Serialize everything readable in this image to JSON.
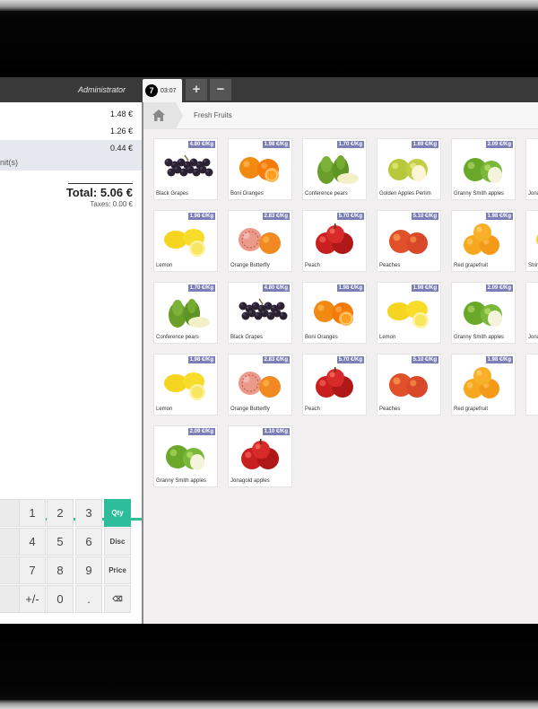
{
  "header": {
    "user": "Administrator",
    "order_number": "7",
    "order_time": "03:07",
    "add_label": "+",
    "remove_label": "−"
  },
  "order": {
    "lines": [
      {
        "price": "1.48 €"
      },
      {
        "price": "1.26 €"
      },
      {
        "price": "0.44 €",
        "unit": "nit(s)"
      }
    ],
    "total": "Total: 5.06 €",
    "taxes": "Taxes: 0.00 €"
  },
  "keypad": {
    "keys": [
      "1",
      "2",
      "3",
      "Qty",
      "4",
      "5",
      "6",
      "Disc",
      "7",
      "8",
      "9",
      "Price",
      "+/-",
      "0",
      ".",
      "⌫"
    ]
  },
  "breadcrumb": {
    "category": "Fresh Fruits"
  },
  "products": [
    {
      "name": "Black Grapes",
      "price": "4.80 €/Kg",
      "icon": "grapes"
    },
    {
      "name": "Boni Oranges",
      "price": "1.98 €/Kg",
      "icon": "orange"
    },
    {
      "name": "Conference pears",
      "price": "1.70 €/Kg",
      "icon": "pear"
    },
    {
      "name": "Golden Apples Perlim",
      "price": "1.69 €/Kg",
      "icon": "golden-apple"
    },
    {
      "name": "Granny Smith apples",
      "price": "2.09 €/Kg",
      "icon": "green-apple"
    },
    {
      "name": "Jona",
      "price": "",
      "icon": "red-apple"
    },
    {
      "name": "Lemon",
      "price": "1.98 €/Kg",
      "icon": "lemon"
    },
    {
      "name": "Orange Butterfly",
      "price": "2.83 €/Kg",
      "icon": "butterfly"
    },
    {
      "name": "Peach",
      "price": "5.70 €/Kg",
      "icon": "red-apple"
    },
    {
      "name": "Peaches",
      "price": "5.10 €/Kg",
      "icon": "peach"
    },
    {
      "name": "Red grapefruit",
      "price": "1.98 €/Kg",
      "icon": "grapefruit"
    },
    {
      "name": "Strir",
      "price": "",
      "icon": "lemon"
    },
    {
      "name": "Conference pears",
      "price": "1.70 €/Kg",
      "icon": "pear"
    },
    {
      "name": "Black Grapes",
      "price": "4.80 €/Kg",
      "icon": "grapes"
    },
    {
      "name": "Boni Oranges",
      "price": "1.98 €/Kg",
      "icon": "orange"
    },
    {
      "name": "Lemon",
      "price": "1.98 €/Kg",
      "icon": "lemon"
    },
    {
      "name": "Granny Smith apples",
      "price": "2.09 €/Kg",
      "icon": "green-apple"
    },
    {
      "name": "Jona",
      "price": "",
      "icon": "red-apple"
    },
    {
      "name": "Lemon",
      "price": "1.98 €/Kg",
      "icon": "lemon"
    },
    {
      "name": "Orange Butterfly",
      "price": "2.83 €/Kg",
      "icon": "butterfly"
    },
    {
      "name": "Peach",
      "price": "5.70 €/Kg",
      "icon": "red-apple"
    },
    {
      "name": "Peaches",
      "price": "5.10 €/Kg",
      "icon": "peach"
    },
    {
      "name": "Red grapefruit",
      "price": "1.98 €/Kg",
      "icon": "grapefruit"
    },
    {
      "name": "",
      "price": "",
      "icon": "green-apple"
    },
    {
      "name": "Granny Smith apples",
      "price": "2.09 €/Kg",
      "icon": "green-apple"
    },
    {
      "name": "Jonagold apples",
      "price": "1.10 €/Kg",
      "icon": "red-apple"
    }
  ]
}
